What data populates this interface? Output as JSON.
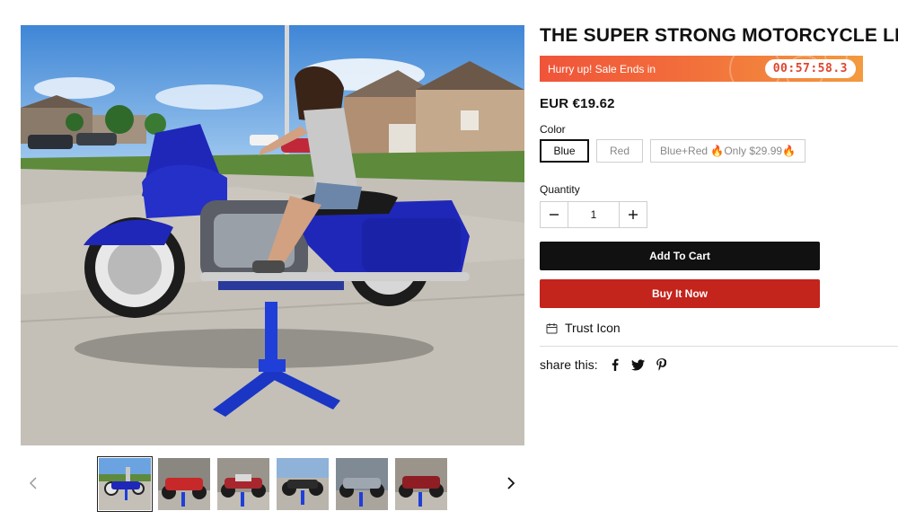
{
  "product": {
    "title": "THE SUPER STRONG MOTORCYCLE LIFT",
    "price": "EUR €19.62"
  },
  "sale_banner": {
    "text": "Hurry up! Sale Ends in",
    "countdown": "00:57:58.3"
  },
  "color": {
    "label": "Color",
    "options": [
      "Blue",
      "Red",
      "Blue+Red 🔥Only $29.99🔥"
    ],
    "selected": "Blue"
  },
  "quantity": {
    "label": "Quantity",
    "value": "1"
  },
  "buttons": {
    "add_to_cart": "Add To Cart",
    "buy_now": "Buy It Now"
  },
  "trust": {
    "label": "Trust Icon"
  },
  "share": {
    "label": "share this:",
    "icons": [
      "facebook-icon",
      "twitter-icon",
      "pinterest-icon"
    ]
  },
  "gallery": {
    "thumbnail_count": 6,
    "active_index": 0
  },
  "colors": {
    "buy_now": "#c3241c",
    "add_to_cart": "#111111",
    "banner_start": "#f0543a",
    "banner_end": "#f39a3f",
    "bike_blue": "#1f27b8"
  }
}
